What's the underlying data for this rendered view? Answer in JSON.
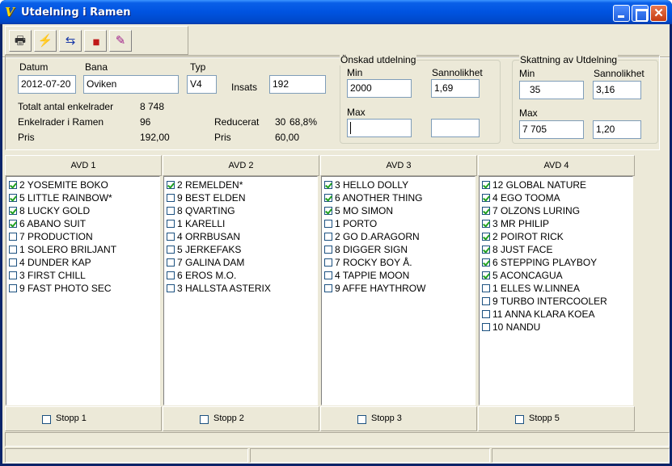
{
  "window": {
    "title": "Utdelning i Ramen",
    "app_icon_glyph": "V",
    "close_glyph": "✕"
  },
  "toolbar": {
    "tools": [
      {
        "name": "print-icon",
        "glyph": "🖶"
      },
      {
        "name": "lightning-icon",
        "glyph": "⚡"
      },
      {
        "name": "swap-icon",
        "glyph": "⇆"
      },
      {
        "name": "bar-chart-icon",
        "glyph": "▮▮"
      },
      {
        "name": "eraser-icon",
        "glyph": "✎"
      }
    ]
  },
  "form": {
    "datum_label": "Datum",
    "datum_value": "2012-07-20",
    "bana_label": "Bana",
    "bana_value": "Oviken",
    "typ_label": "Typ",
    "typ_value": "V4",
    "insats_label": "Insats",
    "insats_value": "192",
    "totalt_label": "Totalt antal enkelrader",
    "totalt_value": "8 748",
    "enkel_label": "Enkelrader i Ramen",
    "enkel_value": "96",
    "reducerat_label": "Reducerat",
    "reducerat_value": "30",
    "reducerat_percent": "68,8%",
    "pris_label": "Pris",
    "pris_value": "192,00",
    "pris2_label": "Pris",
    "pris2_value": "60,00"
  },
  "onskad": {
    "title": "Önskad utdelning",
    "min_label": "Min",
    "sannolikhet_label": "Sannolikhet",
    "min_value": "2000",
    "sannolikhet_value": "1,69",
    "max_label": "Max",
    "max_value": "",
    "max_sannolikhet_value": ""
  },
  "skattning": {
    "title": "Skattning av Utdelning",
    "min_label": "Min",
    "sannolikhet_label": "Sannolikhet",
    "min_value": "35",
    "sannolikhet_value": "3,16",
    "max_label": "Max",
    "max_value": "7 705",
    "max_sannolikhet_value": "1,20"
  },
  "columns": [
    {
      "header": "AVD 1",
      "stopp_label": "Stopp 1",
      "items": [
        {
          "label": "2 YOSEMITE BOKO",
          "checked": true
        },
        {
          "label": "5 LITTLE RAINBOW*",
          "checked": true
        },
        {
          "label": "8 LUCKY GOLD",
          "checked": true
        },
        {
          "label": "6 ABANO SUIT",
          "checked": true
        },
        {
          "label": "7 PRODUCTION",
          "checked": false
        },
        {
          "label": "1 SOLERO BRILJANT",
          "checked": false
        },
        {
          "label": "4 DUNDER KAP",
          "checked": false
        },
        {
          "label": "3 FIRST CHILL",
          "checked": false
        },
        {
          "label": "9 FAST PHOTO SEC",
          "checked": false
        }
      ]
    },
    {
      "header": "AVD 2",
      "stopp_label": "Stopp 2",
      "items": [
        {
          "label": "2 REMELDEN*",
          "checked": true
        },
        {
          "label": "9 BEST ELDEN",
          "checked": false
        },
        {
          "label": "8 QVARTING",
          "checked": false
        },
        {
          "label": "1 KARELLI",
          "checked": false
        },
        {
          "label": "4 ORRBUSAN",
          "checked": false
        },
        {
          "label": "5 JERKEFAKS",
          "checked": false
        },
        {
          "label": "7 GALINA DAM",
          "checked": false
        },
        {
          "label": "6 EROS M.O.",
          "checked": false
        },
        {
          "label": "3 HALLSTA ASTERIX",
          "checked": false
        }
      ]
    },
    {
      "header": "AVD 3",
      "stopp_label": "Stopp 3",
      "items": [
        {
          "label": "3 HELLO DOLLY",
          "checked": true
        },
        {
          "label": "6 ANOTHER THING",
          "checked": true
        },
        {
          "label": "5 MO SIMON",
          "checked": true
        },
        {
          "label": "1 PORTO",
          "checked": false
        },
        {
          "label": "2 GO D.ARAGORN",
          "checked": false
        },
        {
          "label": "8 DIGGER SIGN",
          "checked": false
        },
        {
          "label": "7 ROCKY BOY Å.",
          "checked": false
        },
        {
          "label": "4 TAPPIE MOON",
          "checked": false
        },
        {
          "label": "9 AFFE HAYTHROW",
          "checked": false
        }
      ]
    },
    {
      "header": "AVD 4",
      "stopp_label": "Stopp 5",
      "items": [
        {
          "label": "12 GLOBAL NATURE",
          "checked": true
        },
        {
          "label": "4 EGO TOOMA",
          "checked": true
        },
        {
          "label": "7 OLZONS LURING",
          "checked": true
        },
        {
          "label": "3 MR PHILIP",
          "checked": true
        },
        {
          "label": "2 POIROT RICK",
          "checked": true
        },
        {
          "label": "8 JUST FACE",
          "checked": true
        },
        {
          "label": "6 STEPPING PLAYBOY",
          "checked": true
        },
        {
          "label": "5 ACONCAGUA",
          "checked": true
        },
        {
          "label": "1 ELLES W.LINNEA",
          "checked": false
        },
        {
          "label": "9 TURBO INTERCOOLER",
          "checked": false
        },
        {
          "label": "11 ANNA KLARA KOEA",
          "checked": false
        },
        {
          "label": "10 NANDU",
          "checked": false
        }
      ]
    }
  ],
  "colors": {
    "title_bar": "#0053e0",
    "face": "#ece9d8",
    "check": "#21a121"
  }
}
